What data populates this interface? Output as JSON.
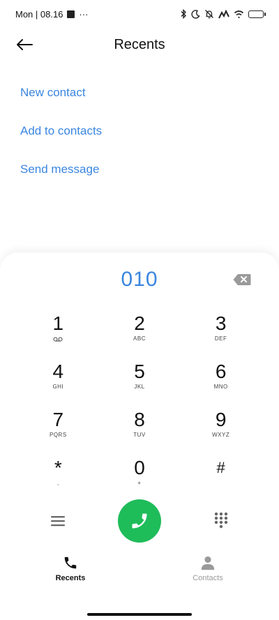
{
  "status_bar": {
    "time": "Mon | 08.16",
    "more": "···"
  },
  "header": {
    "title": "Recents"
  },
  "actions": [
    {
      "label": "New contact"
    },
    {
      "label": "Add to contacts"
    },
    {
      "label": "Send message"
    }
  ],
  "dialer": {
    "number": "010",
    "keys": [
      {
        "digit": "1",
        "letters": ""
      },
      {
        "digit": "2",
        "letters": "ABC"
      },
      {
        "digit": "3",
        "letters": "DEF"
      },
      {
        "digit": "4",
        "letters": "GHI"
      },
      {
        "digit": "5",
        "letters": "JKL"
      },
      {
        "digit": "6",
        "letters": "MNO"
      },
      {
        "digit": "7",
        "letters": "PQRS"
      },
      {
        "digit": "8",
        "letters": "TUV"
      },
      {
        "digit": "9",
        "letters": "WXYZ"
      },
      {
        "digit": "*",
        "letters": ","
      },
      {
        "digit": "0",
        "letters": "+"
      },
      {
        "digit": "#",
        "letters": ""
      }
    ]
  },
  "bottom_nav": {
    "recents": "Recents",
    "contacts": "Contacts"
  },
  "colors": {
    "accent": "#3a86e0",
    "call_green": "#1fbc5a"
  }
}
